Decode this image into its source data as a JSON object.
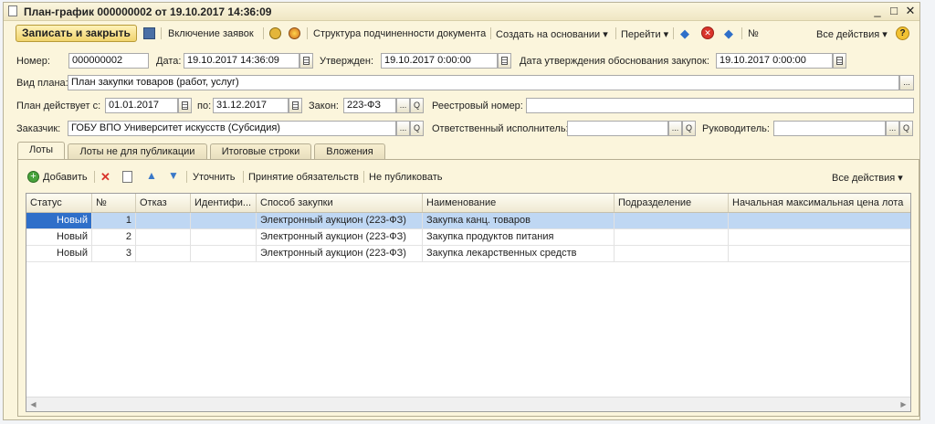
{
  "window": {
    "title": "План-график 000000002 от 19.10.2017 14:36:09",
    "minimize": "_",
    "maximize": "□",
    "close": "✕"
  },
  "toolbar": {
    "save_close": "Записать и закрыть",
    "include_requests": "Включение заявок",
    "doc_structure": "Структура подчиненности документа",
    "create_based_on": "Создать на основании",
    "go_to": "Перейти",
    "number_sign": "№",
    "all_actions": "Все действия",
    "help": "?"
  },
  "header": {
    "number_label": "Номер:",
    "number_value": "000000002",
    "date_label": "Дата:",
    "date_value": "19.10.2017 14:36:09",
    "approved_label": "Утвержден:",
    "approved_value": "19.10.2017  0:00:00",
    "justif_label": "Дата утверждения обоснования закупок:",
    "justif_value": "19.10.2017  0:00:00",
    "plan_type_label": "Вид плана:",
    "plan_type_value": "План закупки товаров (работ, услуг)",
    "valid_from_label": "План действует с:",
    "valid_from_value": "01.01.2017",
    "valid_to_label": "по:",
    "valid_to_value": "31.12.2017",
    "law_label": "Закон:",
    "law_value": "223-ФЗ",
    "registry_label": "Реестровый номер:",
    "registry_value": "",
    "customer_label": "Заказчик:",
    "customer_value": "ГОБУ ВПО Университет искусств (Субсидия)",
    "responsible_label": "Ответственный исполнитель:",
    "responsible_value": "",
    "manager_label": "Руководитель:",
    "manager_value": "",
    "ellipsis": "...",
    "search_glyph": "Q"
  },
  "tabs": [
    "Лоты",
    "Лоты не для публикации",
    "Итоговые строки",
    "Вложения"
  ],
  "lots_toolbar": {
    "add": "Добавить",
    "refine": "Уточнить",
    "accept": "Принятие обязательств",
    "no_publish": "Не публиковать",
    "all_actions": "Все действия"
  },
  "table": {
    "columns": [
      "Статус",
      "№",
      "Отказ",
      "Идентифи...",
      "Способ закупки",
      "Наименование",
      "Подразделение",
      "Начальная максимальная цена лота"
    ],
    "rows": [
      {
        "status": "Новый",
        "num": "1",
        "refusal": "",
        "ident": "",
        "method": "Электронный аукцион (223-ФЗ)",
        "name": "Закупка канц. товаров",
        "dept": "",
        "price": ""
      },
      {
        "status": "Новый",
        "num": "2",
        "refusal": "",
        "ident": "",
        "method": "Электронный аукцион (223-ФЗ)",
        "name": "Закупка продуктов питания",
        "dept": "",
        "price": ""
      },
      {
        "status": "Новый",
        "num": "3",
        "refusal": "",
        "ident": "",
        "method": "Электронный аукцион (223-ФЗ)",
        "name": "Закупка лекарственных средств",
        "dept": "",
        "price": ""
      }
    ]
  }
}
